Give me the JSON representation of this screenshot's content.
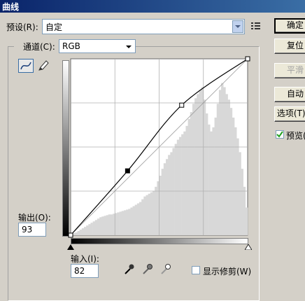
{
  "window": {
    "title": "曲线"
  },
  "preset": {
    "label": "预设(R):",
    "value": "自定"
  },
  "channel": {
    "label": "通道(C):",
    "value": "RGB"
  },
  "buttons": {
    "ok": "确定",
    "reset": "复位",
    "smooth": "平滑",
    "auto": "自动",
    "options": "选项(T)..."
  },
  "preview": {
    "label": "预览(P)",
    "checked": true
  },
  "output": {
    "label": "输出(O):",
    "value": "93"
  },
  "input": {
    "label": "输入(I):",
    "value": "82"
  },
  "clipping": {
    "label": "显示修剪(W)",
    "checked": false
  },
  "curve": {
    "points": [
      [
        0,
        0
      ],
      [
        82,
        93
      ],
      [
        160,
        188
      ],
      [
        255,
        255
      ]
    ]
  },
  "histogram": {
    "color": "#d8d8d8",
    "bins": [
      2,
      3,
      4,
      6,
      8,
      10,
      12,
      14,
      16,
      18,
      20,
      22,
      24,
      26,
      27,
      28,
      29,
      30,
      30,
      31,
      32,
      33,
      34,
      35,
      36,
      37,
      38,
      40,
      42,
      44,
      46,
      48,
      52,
      56,
      58,
      60,
      62,
      64,
      70,
      78,
      86,
      96,
      104,
      110,
      116,
      120,
      126,
      132,
      138,
      142,
      146,
      150,
      158,
      168,
      178,
      190,
      198,
      204,
      210,
      214,
      196,
      176,
      160,
      150,
      156,
      170,
      190,
      210,
      220,
      214,
      204,
      196,
      184,
      170,
      156,
      140,
      120,
      96,
      70,
      40
    ]
  }
}
